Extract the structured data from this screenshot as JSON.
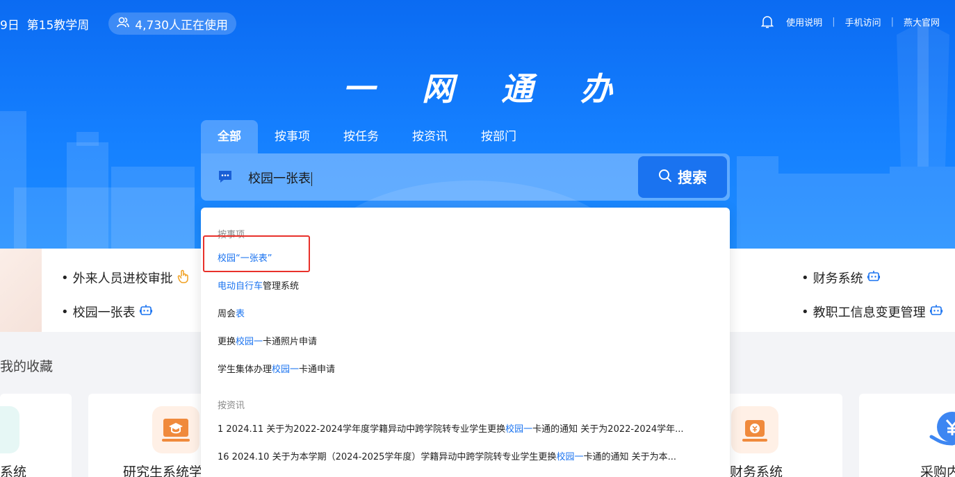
{
  "topbar": {
    "date_fragment": "9日",
    "week": "第15教学周",
    "users_online": "4,730人正在使用",
    "links": [
      "使用说明",
      "手机访问",
      "燕大官网"
    ]
  },
  "hero_title": "一 网 通 办",
  "search": {
    "tabs": [
      "全部",
      "按事项",
      "按任务",
      "按资讯",
      "按部门"
    ],
    "active_tab": "全部",
    "query": "校园一张表",
    "button_label": "搜索"
  },
  "quick_links": {
    "left": [
      "外来人员进校审批",
      "校园一张表"
    ],
    "right": [
      "财务系统",
      "教职工信息变更管理"
    ]
  },
  "favorites": {
    "title": "我的收藏",
    "cards": [
      "系统",
      "研究生系统学",
      "财务系统",
      "采购内"
    ]
  },
  "dropdown": {
    "group_items_title": "按事项",
    "items": [
      {
        "pre": "",
        "hl": "校园“一张表”",
        "post": ""
      },
      {
        "pre": "",
        "hl": "电动自行车",
        "post": "管理系统"
      },
      {
        "pre": "周会",
        "hl": "表",
        "post": ""
      },
      {
        "pre": "更换",
        "hl": "校园一",
        "post": "卡通照片申请"
      },
      {
        "pre": "学生集体办理",
        "hl": "校园一",
        "post": "卡通申请"
      }
    ],
    "group_news_title": "按资讯",
    "news": [
      {
        "pre": "1 2024.11 关于为2022-2024学年度学籍异动中跨学院转专业学生更换",
        "hl": "校园一",
        "post": "卡通的通知 关于为2022-2024学年..."
      },
      {
        "pre": "16 2024.10 关于为本学期（2024-2025学年度）学籍异动中跨学院转专业学生更换",
        "hl": "校园一",
        "post": "卡通的通知 关于为本..."
      }
    ]
  },
  "colors": {
    "primary": "#1a73f0",
    "hero_top": "#0b6bf2",
    "highlight_box": "#e8312a"
  }
}
